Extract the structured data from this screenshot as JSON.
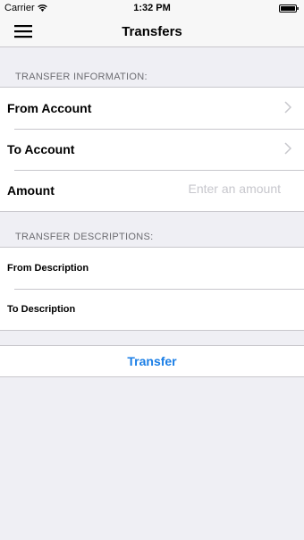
{
  "status_bar": {
    "carrier": "Carrier",
    "time": "1:32 PM",
    "wifi_icon": "wifi-icon",
    "battery_icon": "battery-icon"
  },
  "nav": {
    "title": "Transfers",
    "menu_icon": "hamburger-menu-icon"
  },
  "transfer_info": {
    "header": "TRANSFER INFORMATION:",
    "from_account_label": "From Account",
    "to_account_label": "To Account",
    "amount_label": "Amount",
    "amount_placeholder": "Enter an amount",
    "amount_value": ""
  },
  "transfer_descriptions": {
    "header": "TRANSFER DESCRIPTIONS:",
    "from_description_label": "From Description",
    "to_description_label": "To Description"
  },
  "transfer_button_label": "Transfer",
  "colors": {
    "accent": "#1a7ee6",
    "background": "#efeff4",
    "separator": "#c8c7cc",
    "section_header": "#6d6d72",
    "placeholder": "#c7c7cd"
  }
}
